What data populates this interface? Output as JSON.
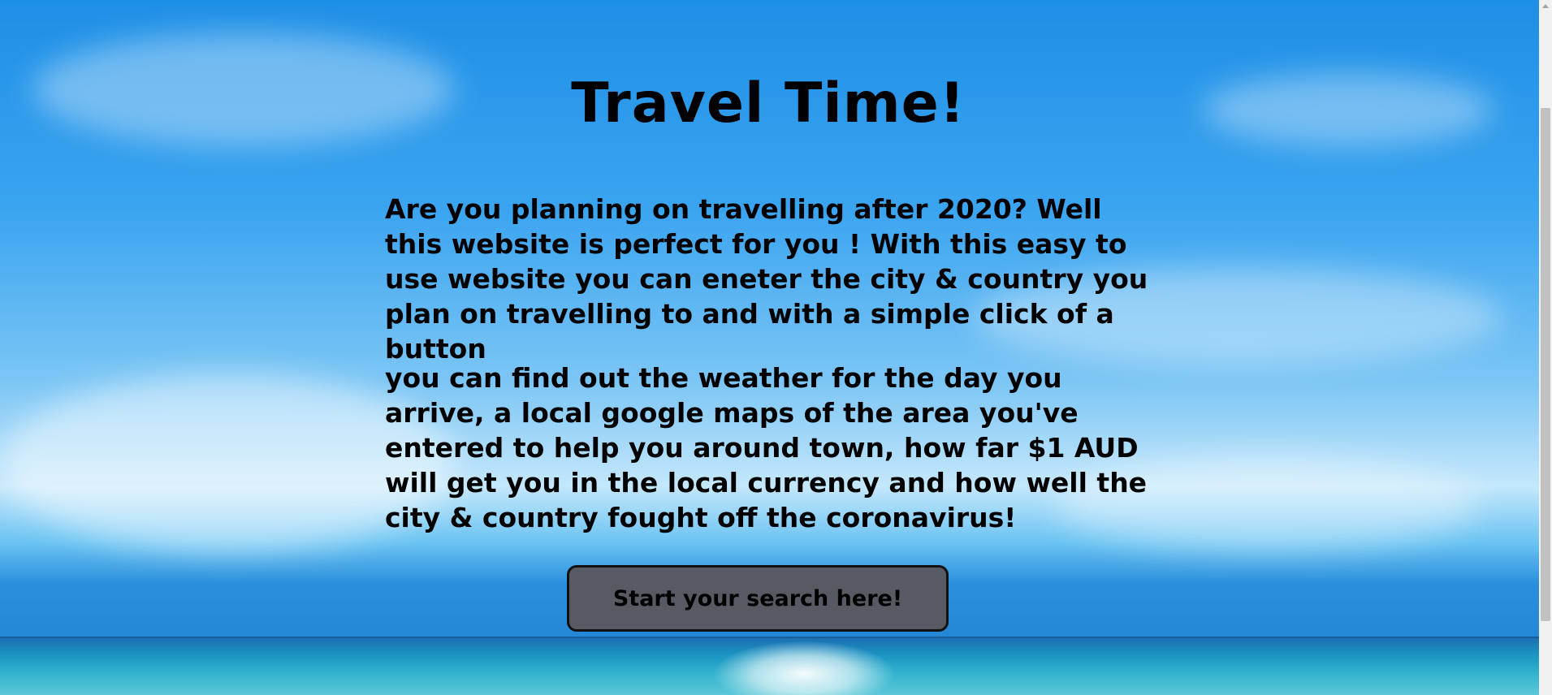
{
  "page": {
    "title": "Travel Time!",
    "paragraph_1": "Are you planning on travelling after 2020? Well this website is perfect for you ! With this easy to use website you can eneter the city & country you plan on travelling to and with a simple click of a button",
    "paragraph_2": "you can find out the weather for the day you arrive, a local google maps of the area you've entered to help you around town, how far $1 AUD will get you in the local currency and how well the city & country fought off the coronavirus!",
    "cta_label": "Start your search here!"
  },
  "theme": {
    "button_color": "#575a63",
    "text_color": "#000000",
    "sky_color": "#3aa4f0",
    "sea_color": "#1b95c2"
  }
}
